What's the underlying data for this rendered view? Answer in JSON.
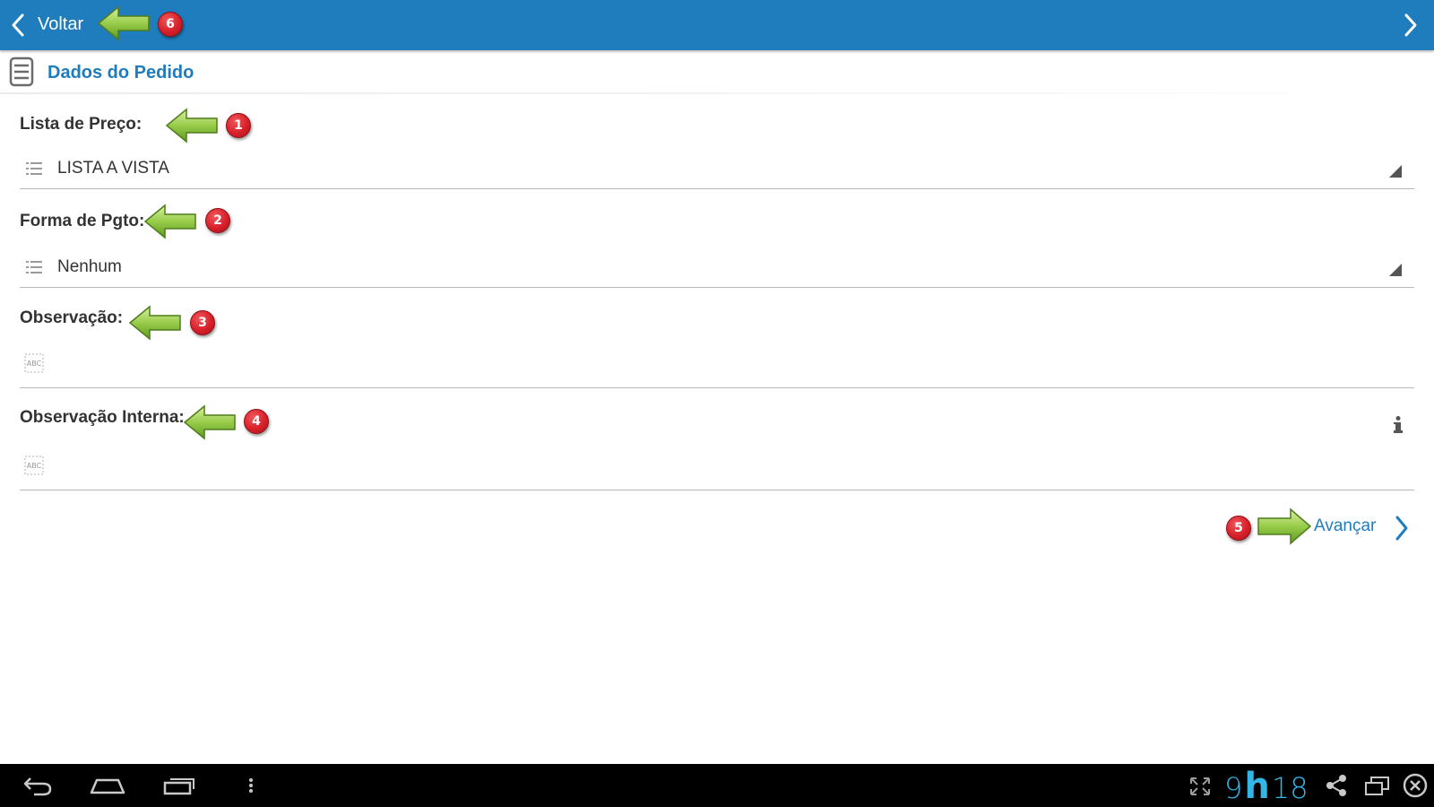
{
  "topbar": {
    "back_label": "Voltar",
    "color": "#1f7dbd"
  },
  "section": {
    "title": "Dados do Pedido",
    "icon": "document-list-icon"
  },
  "fields": {
    "price_list": {
      "label": "Lista de Preço:",
      "value": "LISTA A VISTA"
    },
    "payment": {
      "label": "Forma de Pgto:",
      "value": "Nenhum"
    },
    "note": {
      "label": "Observação:",
      "value": ""
    },
    "internal_note": {
      "label": "Observação Interna:",
      "value": ""
    }
  },
  "advance": {
    "label": "Avançar"
  },
  "annotations": {
    "badge_1": "1",
    "badge_2": "2",
    "badge_3": "3",
    "badge_4": "4",
    "badge_5": "5",
    "badge_6": "6"
  },
  "system_bar": {
    "clock_hours": "9",
    "clock_sep": "h",
    "clock_minutes": "18",
    "clock_color": "#33b5e5"
  }
}
